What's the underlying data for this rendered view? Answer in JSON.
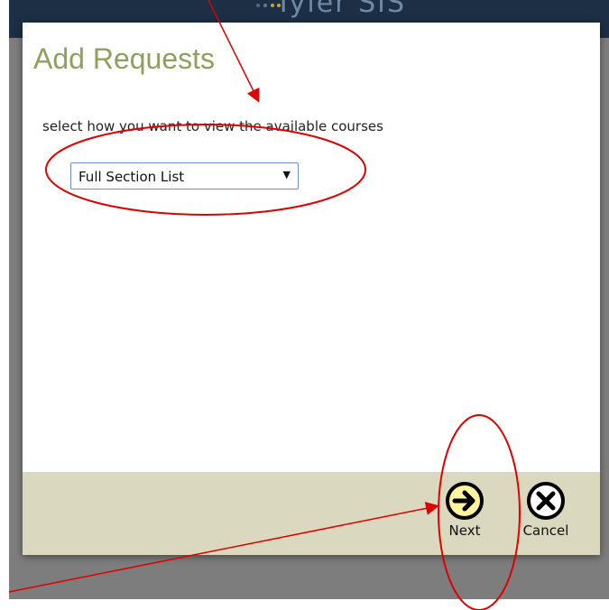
{
  "app": {
    "logo_text": "Tyler SIS"
  },
  "dialog": {
    "title": "Add Requests",
    "instruction": "select how you want to view the available courses",
    "view_select": {
      "selected_value": "Full Section List"
    }
  },
  "footer": {
    "next_label": "Next",
    "cancel_label": "Cancel"
  },
  "colors": {
    "header": "#1d2f45",
    "accent_strip": "#a8802f",
    "title": "#8fa05b",
    "footer": "#dad9bf",
    "next_button_fill": "#fff59d",
    "annotation": "#e00000"
  },
  "icons": [
    "chevron-down-icon",
    "arrow-right-circle-icon",
    "close-circle-icon"
  ]
}
